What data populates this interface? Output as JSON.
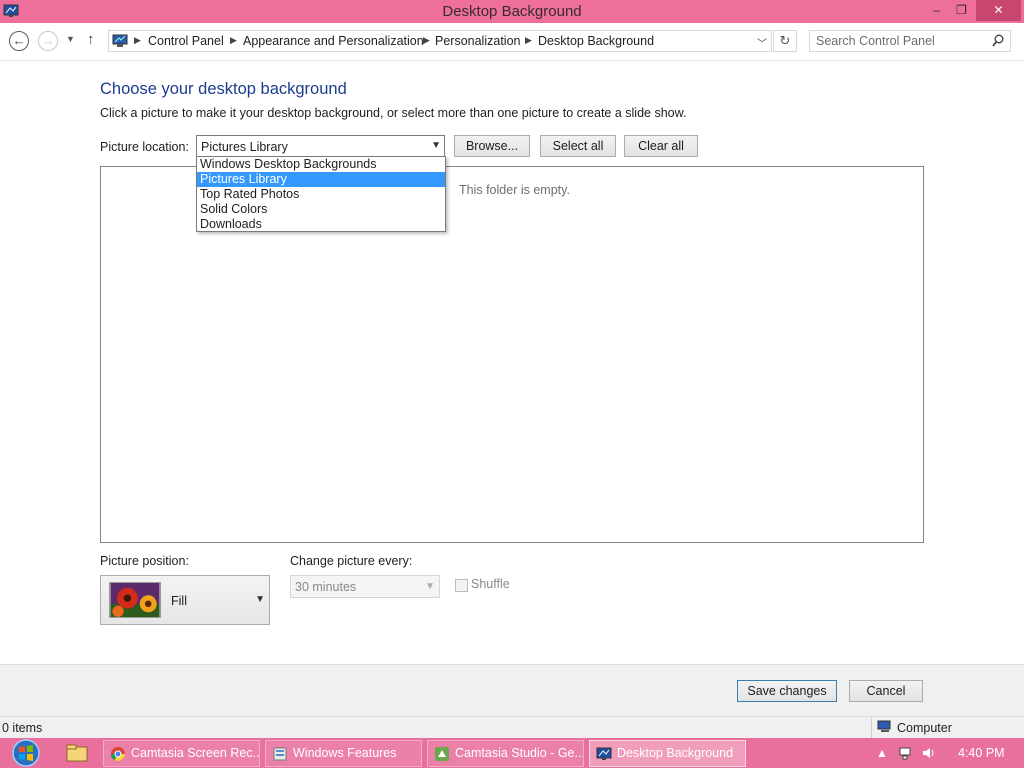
{
  "window": {
    "title": "Desktop Background",
    "app_icon": "desktop-background-icon",
    "controls": {
      "minimize": "–",
      "maximize": "❐",
      "close": "✕"
    }
  },
  "navigation": {
    "back_icon": "back-arrow-icon",
    "forward_icon": "forward-arrow-icon",
    "recent_icon": "chevron-down-icon",
    "up_icon": "up-arrow-icon",
    "breadcrumb": [
      "Control Panel",
      "Appearance and Personalization",
      "Personalization",
      "Desktop Background"
    ],
    "refresh_icon": "refresh-icon",
    "search_placeholder": "Search Control Panel",
    "search_icon": "search-icon"
  },
  "main": {
    "heading": "Choose your desktop background",
    "description": "Click a picture to make it your desktop background, or select more than one picture to create a slide show.",
    "picture_location": {
      "label": "Picture location:",
      "selected": "Pictures Library",
      "options": [
        "Windows Desktop Backgrounds",
        "Pictures Library",
        "Top Rated Photos",
        "Solid Colors",
        "Downloads"
      ],
      "highlighted_index": 1
    },
    "buttons": {
      "browse": "Browse...",
      "select_all": "Select all",
      "clear_all": "Clear all"
    },
    "empty_message": "This folder is empty.",
    "picture_position": {
      "label": "Picture position:",
      "value": "Fill"
    },
    "change_picture": {
      "label": "Change picture every:",
      "value": "30 minutes",
      "enabled": false
    },
    "shuffle": {
      "label": "Shuffle",
      "checked": false,
      "enabled": false
    }
  },
  "footer": {
    "save": "Save changes",
    "cancel": "Cancel"
  },
  "statusbar": {
    "items": "0 items",
    "location": "Computer"
  },
  "taskbar": {
    "tasks": [
      {
        "label": "Camtasia Screen Rec...",
        "icon": "chrome-icon",
        "active": false
      },
      {
        "label": "Windows Features",
        "icon": "windows-features-icon",
        "active": false
      },
      {
        "label": "Camtasia Studio - Ge...",
        "icon": "camtasia-studio-icon",
        "active": false
      },
      {
        "label": "Desktop Background",
        "icon": "desktop-background-icon",
        "active": true
      }
    ],
    "clock": "4:40 PM"
  },
  "colors": {
    "accent_pink": "#ee6f9c",
    "heading_blue": "#1c3d8c",
    "selection_blue": "#3399ff"
  }
}
